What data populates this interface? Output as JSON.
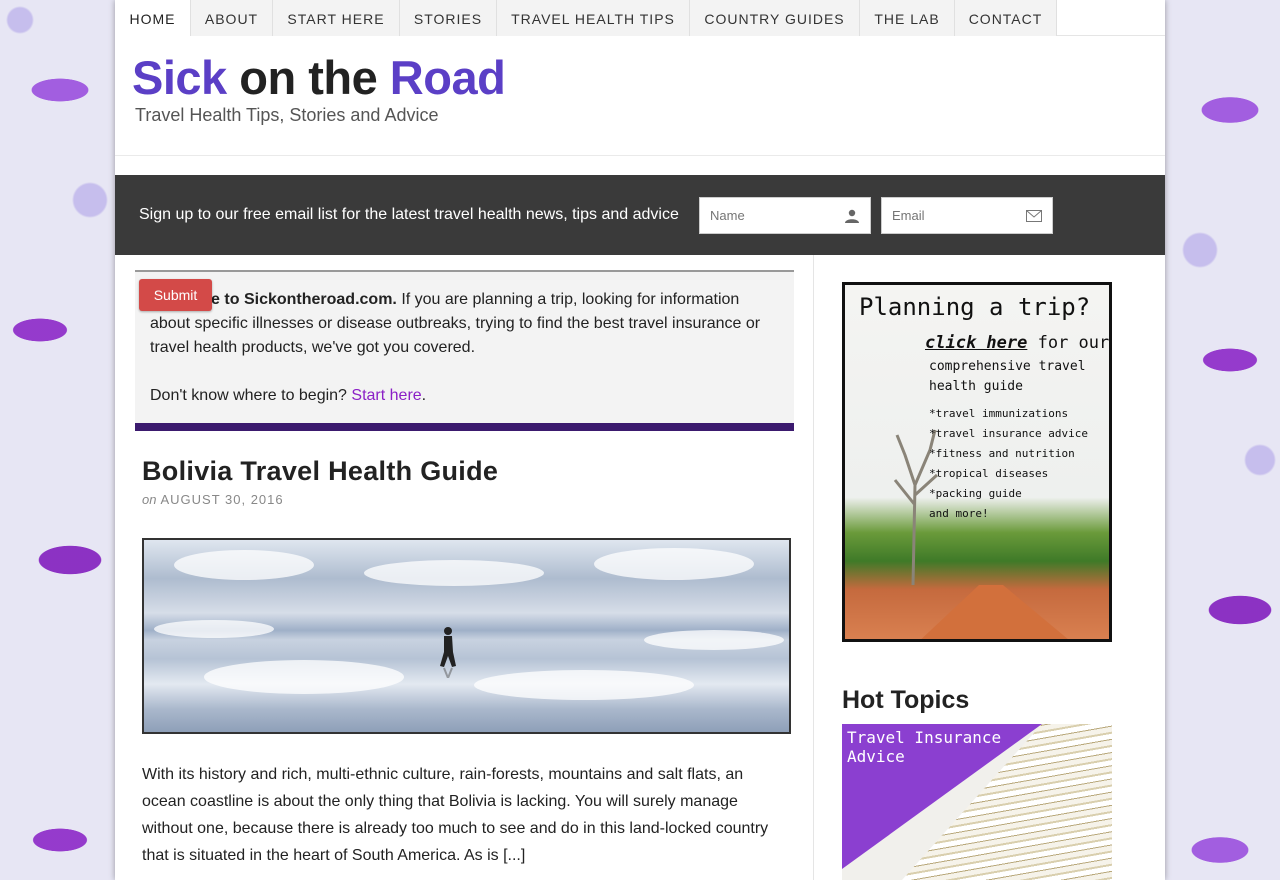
{
  "nav": {
    "items": [
      {
        "label": "HOME"
      },
      {
        "label": "ABOUT"
      },
      {
        "label": "START HERE"
      },
      {
        "label": "STORIES"
      },
      {
        "label": "TRAVEL HEALTH TIPS"
      },
      {
        "label": "COUNTRY GUIDES"
      },
      {
        "label": "THE LAB"
      },
      {
        "label": "CONTACT"
      }
    ],
    "active": "HOME"
  },
  "header": {
    "logo_part1": "Sick",
    "logo_part2": "on the",
    "logo_part3": "Road",
    "tagline": "Travel Health Tips, Stories and Advice"
  },
  "signup": {
    "text": "Sign up to our free email list for the latest travel health news, tips and advice",
    "name_placeholder": "Name",
    "email_placeholder": "Email",
    "submit_label": "Submit"
  },
  "welcome": {
    "bold_lead": "Welcome to Sickontheroad.com.",
    "body": " If you are planning a trip, looking for information about specific illnesses or disease outbreaks, trying to find the best travel insurance or travel health products, we've got you covered.",
    "begin_text": "Don't know where to begin? ",
    "begin_link": "Start here",
    "begin_end": "."
  },
  "post": {
    "title": "Bolivia Travel Health Guide",
    "meta_on": "on",
    "date": "AUGUST 30, 2016",
    "excerpt": "With its history and rich, multi-ethnic culture, rain-forests, mountains and salt flats, an ocean coastline is about the only thing that Bolivia is lacking. You will surely manage without one, because there is already too much to see and do in this land-locked country that is situated in the heart of South America. As is [...]"
  },
  "sidebar": {
    "ad": {
      "headline": "Planning a trip?",
      "click_here": "click here",
      "for_our": " for our",
      "line2": "comprehensive travel",
      "line3": "health guide",
      "bullets": [
        "*travel immunizations",
        "*travel insurance advice",
        "*fitness and nutrition",
        "*tropical diseases",
        "*packing guide",
        "and more!"
      ]
    },
    "hot_topics_title": "Hot Topics",
    "hot_card_label": "Travel Insurance\nAdvice"
  },
  "colors": {
    "brand_purple": "#5b3fc6",
    "link_purple": "#8b1fc6",
    "signup_bg": "#3a3a3a",
    "submit_red": "#d34a48",
    "welcome_bar": "#3b1a6e"
  }
}
